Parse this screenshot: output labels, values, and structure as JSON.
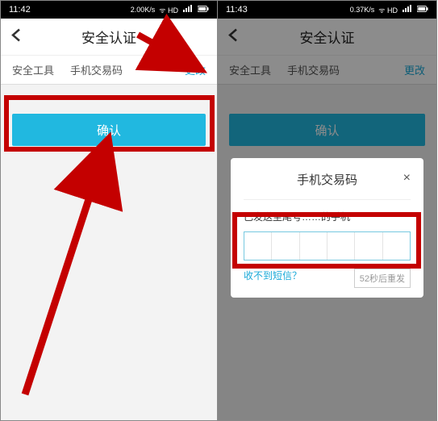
{
  "phone1": {
    "status_time": "11:42",
    "status_net": "2.00K/s",
    "header_title": "安全认证",
    "section_label": "安全工具",
    "section_value": "手机交易码",
    "section_action": "更改",
    "confirm_label": "确认"
  },
  "phone2": {
    "status_time": "11:43",
    "status_net": "0.37K/s",
    "header_title": "安全认证",
    "section_label": "安全工具",
    "section_value": "手机交易码",
    "section_action": "更改",
    "confirm_label": "确认",
    "modal": {
      "title": "手机交易码",
      "desc": "已发送至尾号……的手机",
      "sms_link": "收不到短信？",
      "resend": "52秒后重发"
    }
  }
}
